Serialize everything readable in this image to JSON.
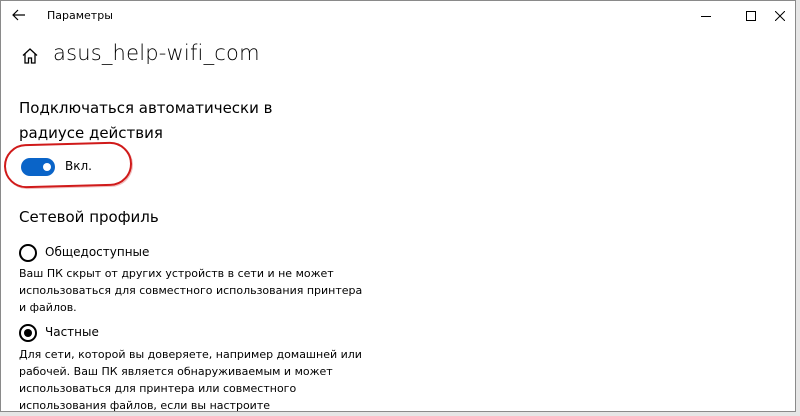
{
  "window": {
    "title": "Параметры"
  },
  "header": {
    "title": "asus_help-wifi_com"
  },
  "auto_connect": {
    "heading": "Подключаться автоматически в радиусе действия",
    "toggle_state": "Вкл.",
    "enabled": true
  },
  "network_profile": {
    "heading": "Сетевой профиль",
    "options": [
      {
        "label": "Общедоступные",
        "selected": false,
        "description": "Ваш ПК скрыт от других устройств в сети и не может использоваться для совместного использования принтера и файлов."
      },
      {
        "label": "Частные",
        "selected": true,
        "description": "Для сети, которой вы доверяете, например домашней или рабочей. Ваш ПК является обнаруживаемым и может использоваться для принтера или совместного использования файлов, если вы настроите соответствующие параметры."
      }
    ]
  },
  "colors": {
    "accent": "#0a64c8",
    "annotation": "#d01a1a"
  }
}
